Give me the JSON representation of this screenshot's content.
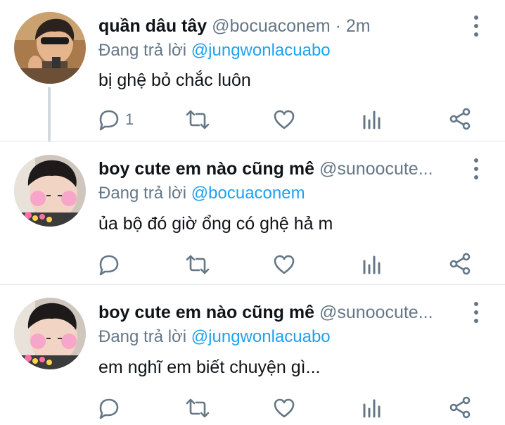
{
  "colors": {
    "text": "#0f1419",
    "muted": "#657786",
    "accent": "#1da1f2",
    "divider": "#e1e8ed"
  },
  "tweets": [
    {
      "name": "quần dâu tây",
      "handle": "@bocuaconem",
      "time": "· 2m",
      "replying_prefix": "Đang trả lời ",
      "replying_to": "@jungwonlacuabo",
      "text": "bị ghệ bỏ chắc luôn",
      "reply_count": "1",
      "icons": [
        "reply-icon",
        "retweet-icon",
        "like-icon",
        "analytics-icon",
        "share-icon"
      ]
    },
    {
      "name": "boy cute em nào cũng mê",
      "handle": "@sunoocute...",
      "replying_prefix": "Đang trả lời ",
      "replying_to": "@bocuaconem",
      "text": "ủa bộ đó giờ ổng có ghệ hả m",
      "reply_count": "",
      "icons": [
        "reply-icon",
        "retweet-icon",
        "like-icon",
        "analytics-icon",
        "share-icon"
      ]
    },
    {
      "name": "boy cute em nào cũng mê",
      "handle": "@sunoocute...",
      "replying_prefix": "Đang trả lời ",
      "replying_to": "@jungwonlacuabo",
      "text": "em nghĩ em biết chuyện gì...",
      "reply_count": "",
      "icons": [
        "reply-icon",
        "retweet-icon",
        "like-icon",
        "analytics-icon",
        "share-icon"
      ]
    }
  ]
}
